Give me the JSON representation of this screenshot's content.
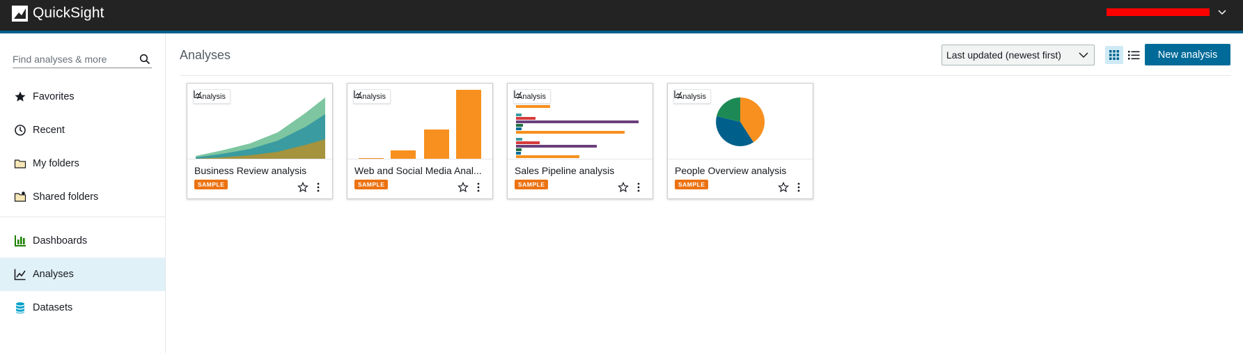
{
  "app": {
    "name": "QuickSight",
    "logo_icon": "quicksight-logo-icon",
    "account_chevron_icon": "chevron-down-icon"
  },
  "sidebar": {
    "search_placeholder": "Find analyses & more",
    "items": [
      {
        "label": "Favorites",
        "icon": "star-icon"
      },
      {
        "label": "Recent",
        "icon": "clock-icon"
      },
      {
        "label": "My folders",
        "icon": "folder-icon"
      },
      {
        "label": "Shared folders",
        "icon": "shared-folder-icon"
      },
      {
        "label": "Dashboards",
        "icon": "dashboard-icon"
      },
      {
        "label": "Analyses",
        "icon": "analysis-icon",
        "active": true
      },
      {
        "label": "Datasets",
        "icon": "dataset-icon"
      }
    ]
  },
  "main": {
    "title": "Analyses",
    "sort": {
      "selected": "Last updated (newest first)"
    },
    "view": {
      "mode": "grid"
    },
    "new_button": "New analysis"
  },
  "cards": [
    {
      "title": "Business Review analysis",
      "badge": "Analysis",
      "tag": "SAMPLE",
      "thumbnail": "stacked-area-chart"
    },
    {
      "title": "Web and Social Media Anal...",
      "badge": "Analysis",
      "tag": "SAMPLE",
      "thumbnail": "bar-chart"
    },
    {
      "title": "Sales Pipeline analysis",
      "badge": "Analysis",
      "tag": "SAMPLE",
      "thumbnail": "horizontal-bar-chart"
    },
    {
      "title": "People Overview analysis",
      "badge": "Analysis",
      "tag": "SAMPLE",
      "thumbnail": "pie-chart"
    }
  ],
  "colors": {
    "topbar": "#232323",
    "accent": "#00608b",
    "primary_button": "#006b99",
    "active_nav_bg": "#e1f1f8",
    "sample_tag": "#ec7211"
  }
}
